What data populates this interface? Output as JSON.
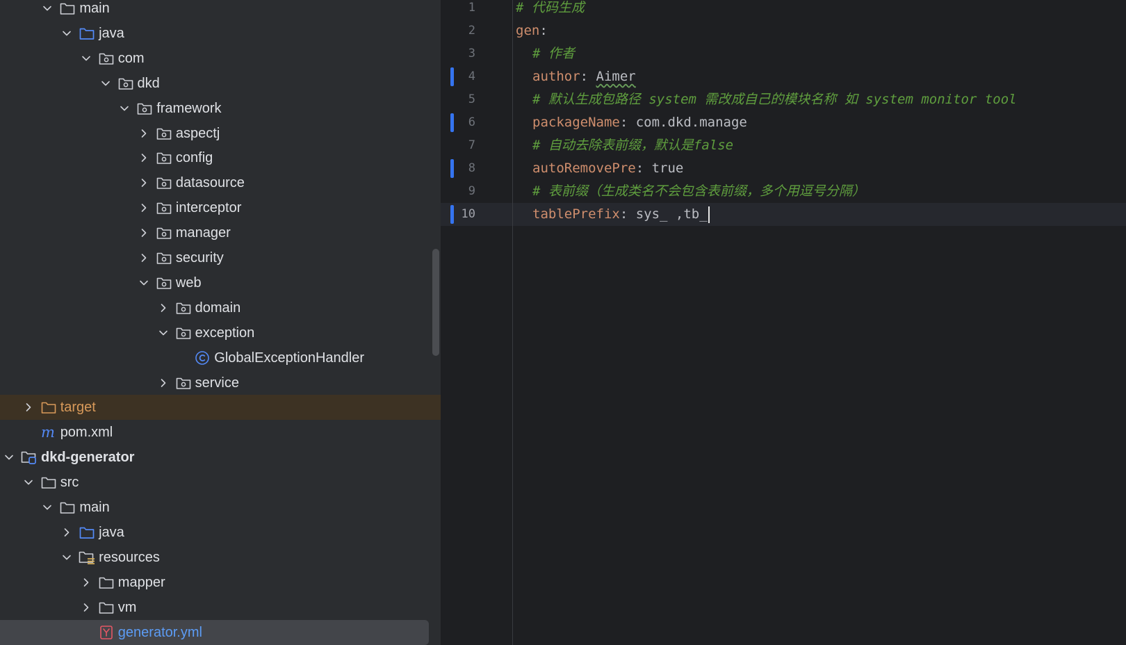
{
  "tree": {
    "rows": [
      {
        "label": "main",
        "depth": 2,
        "arrow": "down",
        "icon": "folder-icon"
      },
      {
        "label": "java",
        "depth": 3,
        "arrow": "down",
        "icon": "source-folder-icon"
      },
      {
        "label": "com",
        "depth": 4,
        "arrow": "down",
        "icon": "package-icon"
      },
      {
        "label": "dkd",
        "depth": 5,
        "arrow": "down",
        "icon": "package-icon"
      },
      {
        "label": "framework",
        "depth": 6,
        "arrow": "down",
        "icon": "package-icon"
      },
      {
        "label": "aspectj",
        "depth": 7,
        "arrow": "right",
        "icon": "package-icon"
      },
      {
        "label": "config",
        "depth": 7,
        "arrow": "right",
        "icon": "package-icon"
      },
      {
        "label": "datasource",
        "depth": 7,
        "arrow": "right",
        "icon": "package-icon"
      },
      {
        "label": "interceptor",
        "depth": 7,
        "arrow": "right",
        "icon": "package-icon"
      },
      {
        "label": "manager",
        "depth": 7,
        "arrow": "right",
        "icon": "package-icon"
      },
      {
        "label": "security",
        "depth": 7,
        "arrow": "right",
        "icon": "package-icon"
      },
      {
        "label": "web",
        "depth": 7,
        "arrow": "down",
        "icon": "package-icon"
      },
      {
        "label": "domain",
        "depth": 8,
        "arrow": "right",
        "icon": "package-icon"
      },
      {
        "label": "exception",
        "depth": 8,
        "arrow": "down",
        "icon": "package-icon"
      },
      {
        "label": "GlobalExceptionHandler",
        "depth": 9,
        "arrow": "none",
        "icon": "java-class-icon"
      },
      {
        "label": "service",
        "depth": 8,
        "arrow": "right",
        "icon": "package-icon"
      },
      {
        "label": "target",
        "depth": 1,
        "arrow": "right",
        "icon": "excluded-folder-icon",
        "style": "excluded"
      },
      {
        "label": "pom.xml",
        "depth": 1,
        "arrow": "none",
        "icon": "maven-icon"
      },
      {
        "label": "dkd-generator",
        "depth": 0,
        "arrow": "down",
        "icon": "module-icon",
        "style": "module"
      },
      {
        "label": "src",
        "depth": 1,
        "arrow": "down",
        "icon": "folder-icon"
      },
      {
        "label": "main",
        "depth": 2,
        "arrow": "down",
        "icon": "folder-icon"
      },
      {
        "label": "java",
        "depth": 3,
        "arrow": "right",
        "icon": "source-folder-icon"
      },
      {
        "label": "resources",
        "depth": 3,
        "arrow": "down",
        "icon": "resources-folder-icon"
      },
      {
        "label": "mapper",
        "depth": 4,
        "arrow": "right",
        "icon": "folder-icon"
      },
      {
        "label": "vm",
        "depth": 4,
        "arrow": "right",
        "icon": "folder-icon"
      },
      {
        "label": "generator.yml",
        "depth": 4,
        "arrow": "none",
        "icon": "yaml-file-icon",
        "style": "selected"
      }
    ]
  },
  "editor": {
    "lines": [
      {
        "num": "1",
        "tokens": [
          {
            "t": "# 代码生成",
            "c": "c"
          }
        ],
        "indent": 0
      },
      {
        "num": "2",
        "tokens": [
          {
            "t": "gen",
            "c": "k"
          },
          {
            "t": ":",
            "c": "v"
          }
        ],
        "indent": 0
      },
      {
        "num": "3",
        "tokens": [
          {
            "t": "# 作者",
            "c": "c"
          }
        ],
        "indent": 1
      },
      {
        "num": "4",
        "tokens": [
          {
            "t": "author",
            "c": "k"
          },
          {
            "t": ": ",
            "c": "v"
          },
          {
            "t": "Aimer",
            "c": "v typo"
          }
        ],
        "indent": 1,
        "changed": true
      },
      {
        "num": "5",
        "tokens": [
          {
            "t": "# 默认生成包路径 system 需改成自己的模块名称 如 system monitor tool",
            "c": "c"
          }
        ],
        "indent": 1
      },
      {
        "num": "6",
        "tokens": [
          {
            "t": "packageName",
            "c": "k"
          },
          {
            "t": ": com.dkd.manage",
            "c": "v"
          }
        ],
        "indent": 1,
        "changed": true
      },
      {
        "num": "7",
        "tokens": [
          {
            "t": "# 自动去除表前缀，默认是false",
            "c": "c"
          }
        ],
        "indent": 1
      },
      {
        "num": "8",
        "tokens": [
          {
            "t": "autoRemovePre",
            "c": "k"
          },
          {
            "t": ": true",
            "c": "v"
          }
        ],
        "indent": 1,
        "changed": true
      },
      {
        "num": "9",
        "tokens": [
          {
            "t": "# 表前缀（生成类名不会包含表前缀，多个用逗号分隔）",
            "c": "c"
          }
        ],
        "indent": 1
      },
      {
        "num": "10",
        "tokens": [
          {
            "t": "tablePrefix",
            "c": "k"
          },
          {
            "t": ": sys_ ,tb_",
            "c": "v"
          }
        ],
        "indent": 1,
        "changed": true,
        "active": true,
        "caret": true
      }
    ]
  },
  "colors": {
    "tree_bg": "#2b2d30",
    "editor_bg": "#1e1f22",
    "key": "#cf8e6d",
    "comment": "#5f9e3e",
    "excluded": "#d99a5a",
    "selected_text": "#5c9cf5",
    "change_marker": "#3574f0"
  }
}
